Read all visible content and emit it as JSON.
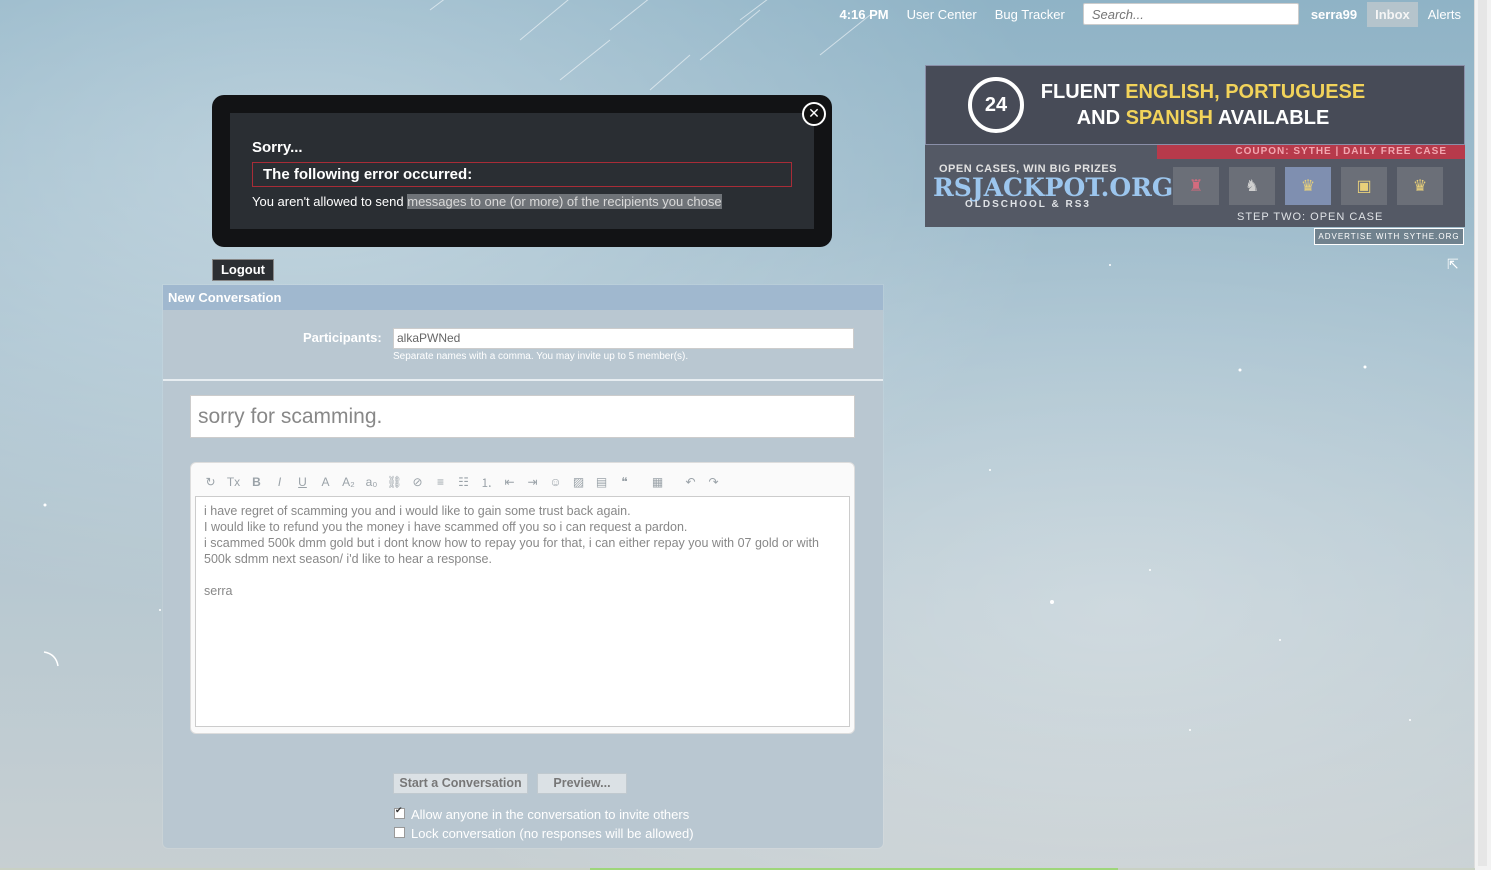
{
  "topnav": {
    "time": "4:16 PM",
    "user_center": "User Center",
    "bug_tracker": "Bug Tracker",
    "search_placeholder": "Search...",
    "username": "serra99",
    "inbox": "Inbox",
    "alerts": "Alerts"
  },
  "ads": {
    "ad1": {
      "badge": "24",
      "line1_white": "FLUENT ",
      "line1_yellow": "ENGLISH, PORTUGUESE",
      "line2_white1": "AND ",
      "line2_yellow": "SPANISH",
      "line2_white2": " AVAILABLE"
    },
    "ad2": {
      "coupon": "COUPON: SYTHE | DAILY FREE CASE",
      "open_cases": "OPEN CASES, WIN BIG PRIZES",
      "brand": "RSJACKPOT.ORG",
      "sub": "OLDSCHOOL & RS3",
      "step": "STEP TWO: OPEN CASE"
    },
    "advertise": "ADVERTISE WITH SYTHE.ORG"
  },
  "error": {
    "sorry": "Sorry...",
    "heading": "The following error occurred:",
    "message_prefix": "You aren't allowed to send ",
    "message_selected": "messages to one (or more) of the recipients you chose"
  },
  "logout_label": "Logout",
  "conversation": {
    "header": "New Conversation",
    "participants_label": "Participants:",
    "participants_value": "alkaPWNed",
    "participants_hint": "Separate names with a comma. You may invite up to 5 member(s).",
    "title_value": "sorry for scamming.",
    "body_lines": [
      "i have regret of scamming you and i would like to gain some trust back again.",
      "I would like to refund you the money i have scammed off you so i can request a pardon.",
      "i scammed 500k dmm gold but i dont know how to repay you for that, i can either repay you with 07 gold or with 500k sdmm next season/ i'd like to hear a response."
    ],
    "signature": "serra",
    "start_button": "Start a Conversation",
    "preview_button": "Preview...",
    "option_invite": "Allow anyone in the conversation to invite others",
    "option_invite_checked": true,
    "option_lock": "Lock conversation (no responses will be allowed)",
    "option_lock_checked": false
  },
  "toolbar_icons": [
    "remove-format-icon",
    "clear-icon",
    "bold-icon",
    "italic-icon",
    "underline-icon",
    "text-color-icon",
    "font-size-icon",
    "font-family-icon",
    "link-icon",
    "unlink-icon",
    "align-icon",
    "bullet-list-icon",
    "numbered-list-icon",
    "outdent-icon",
    "indent-icon",
    "smiley-icon",
    "image-icon",
    "media-icon",
    "quote-icon",
    "draft-icon",
    "undo-icon",
    "redo-icon"
  ]
}
